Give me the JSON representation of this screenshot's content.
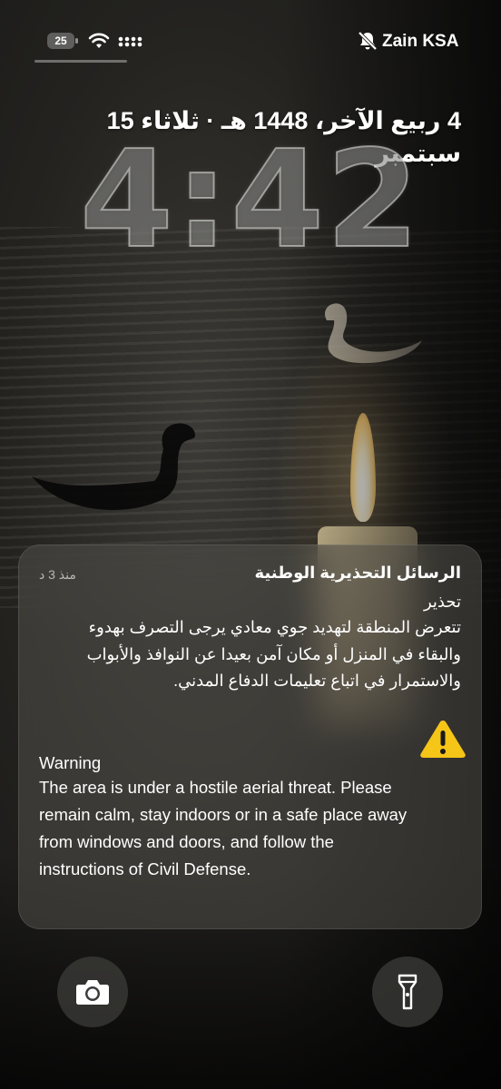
{
  "status_bar": {
    "battery_level": "25",
    "carrier": "Zain KSA",
    "icons": [
      "battery-icon",
      "wifi-icon",
      "cellular-signal-icon",
      "bell-slash-icon"
    ]
  },
  "lock_screen": {
    "date": "4 ربيع الآخر، 1448 هـ · ثلاثاء 15 سبتمبر",
    "time": "4:42"
  },
  "notification": {
    "app_title": "الرسائل التحذيرية الوطنية",
    "time_ago": "منذ 3 د",
    "arabic_heading": "تحذير",
    "arabic_body": "تتعرض المنطقة لتهديد جوي معادي يرجى التصرف بهدوء والبقاء في المنزل أو مكان آمن بعيدا عن النوافذ والأبواب والاستمرار في اتباع تعليمات الدفاع المدني.",
    "english_heading": "Warning",
    "english_body": "The area is under a hostile aerial threat. Please remain calm, stay indoors or in a safe place away from windows and doors, and follow the instructions of Civil Defense.",
    "icon": "warning-triangle-icon",
    "icon_color": "#F5C518"
  },
  "quick_actions": {
    "left": "camera-icon",
    "right": "flashlight-icon"
  }
}
